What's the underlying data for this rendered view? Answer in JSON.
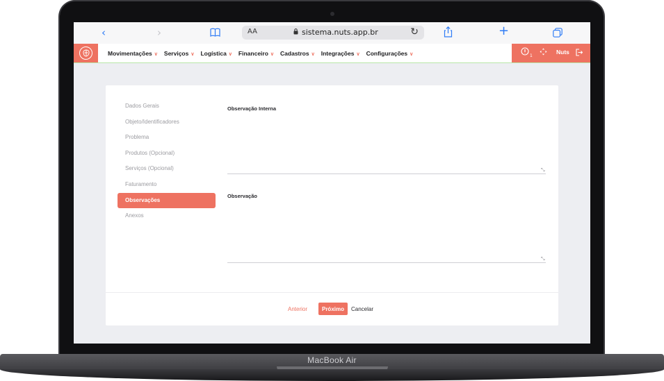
{
  "device": {
    "brand_label": "MacBook Air"
  },
  "browser": {
    "url": "sistema.nuts.app.br",
    "aa_label": "AA",
    "icons": {
      "back": "chevron-left-icon",
      "forward": "chevron-right-icon",
      "bookmarks": "book-icon",
      "lock": "lock-icon",
      "reload": "reload-icon",
      "share": "share-icon",
      "new_tab": "plus-icon",
      "tabs": "tabs-icon"
    }
  },
  "nav": {
    "items": [
      {
        "label": "Movimentações"
      },
      {
        "label": "Serviços"
      },
      {
        "label": "Logística"
      },
      {
        "label": "Financeiro"
      },
      {
        "label": "Cadastros"
      },
      {
        "label": "Integrações"
      },
      {
        "label": "Configurações"
      }
    ],
    "notification_count": "1",
    "user_name": "Nuts",
    "accent_color": "#ee7261"
  },
  "steps": [
    {
      "label": "Dados Gerais",
      "active": false
    },
    {
      "label": "Objeto/Identificadores",
      "active": false
    },
    {
      "label": "Problema",
      "active": false
    },
    {
      "label": "Produtos (Opcional)",
      "active": false
    },
    {
      "label": "Serviços (Opcional)",
      "active": false
    },
    {
      "label": "Faturamento",
      "active": false
    },
    {
      "label": "Observações",
      "active": true
    },
    {
      "label": "Anexos",
      "active": false
    }
  ],
  "form": {
    "internal_note_label": "Observação Interna",
    "internal_note_value": "",
    "note_label": "Observação",
    "note_value": ""
  },
  "actions": {
    "prev_label": "Anterior",
    "next_label": "Próximo",
    "cancel_label": "Cancelar"
  }
}
